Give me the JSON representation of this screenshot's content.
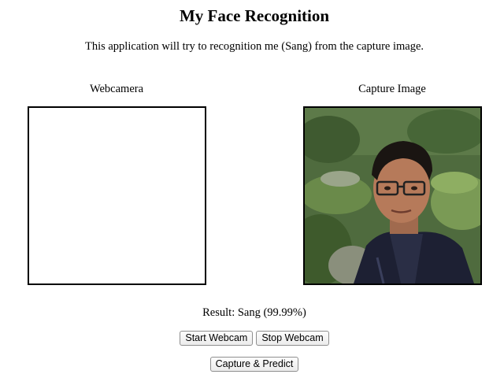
{
  "header": {
    "title": "My Face Recognition",
    "subtitle": "This application will try to recognition me (Sang) from the capture image."
  },
  "panels": {
    "webcam_label": "Webcamera",
    "capture_label": "Capture Image"
  },
  "result": {
    "text": "Result: Sang (99.99%)"
  },
  "buttons": {
    "start_webcam": "Start Webcam",
    "stop_webcam": "Stop Webcam",
    "capture_predict": "Capture & Predict"
  },
  "colors": {
    "frame_border": "#000000",
    "background": "#ffffff"
  }
}
